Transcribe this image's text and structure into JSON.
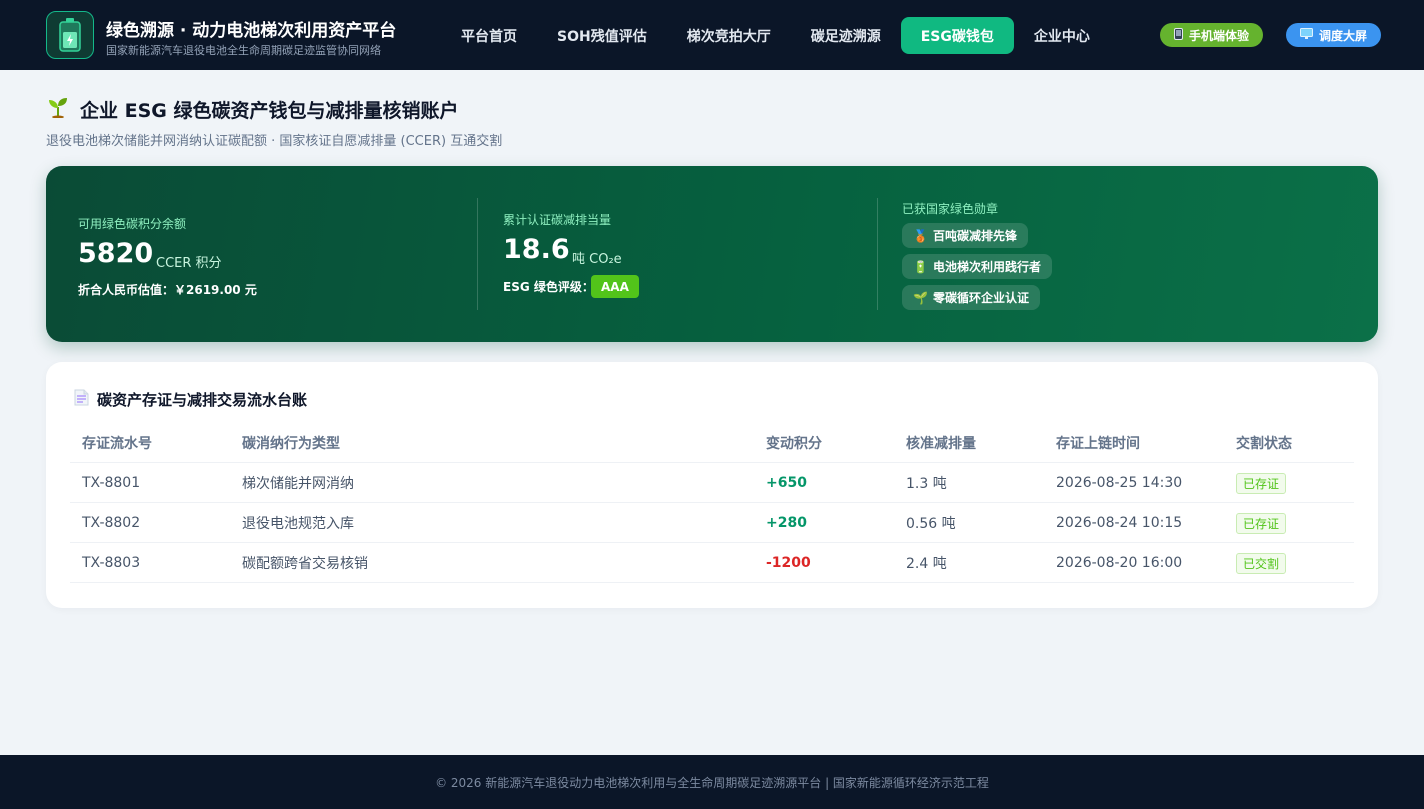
{
  "header": {
    "brand_title": "绿色溯源 · 动力电池梯次利用资产平台",
    "brand_subtitle": "国家新能源汽车退役电池全生命周期碳足迹监管协同网络",
    "nav": [
      {
        "label": "平台首页",
        "active": false
      },
      {
        "label": "SOH残值评估",
        "active": false
      },
      {
        "label": "梯次竞拍大厅",
        "active": false
      },
      {
        "label": "碳足迹溯源",
        "active": false
      },
      {
        "label": "ESG碳钱包",
        "active": true
      },
      {
        "label": "企业中心",
        "active": false
      }
    ],
    "mobile_label": "手机端体验",
    "screen_label": "调度大屏"
  },
  "page": {
    "title": "企业 ESG 绿色碳资产钱包与减排量核销账户",
    "subtitle": "退役电池梯次储能并网消纳认证碳配额 · 国家核证自愿减排量 (CCER) 互通交割"
  },
  "wallet": {
    "balance_label": "可用绿色碳积分余额",
    "balance_value": "5820",
    "balance_unit": "CCER 积分",
    "rmb_estimate": "折合人民币估值：￥2619.00 元",
    "reduction_label": "累计认证碳减排当量",
    "reduction_value": "18.6",
    "reduction_unit": "吨 CO₂e",
    "rating_label": "ESG 绿色评级：",
    "rating_value": "AAA",
    "medals_label": "已获国家绿色勋章",
    "medals": [
      {
        "icon": "🥉",
        "label": "百吨碳减排先锋"
      },
      {
        "icon": "🔋",
        "label": "电池梯次利用践行者"
      },
      {
        "icon": "🌱",
        "label": "零碳循环企业认证"
      }
    ]
  },
  "ledger": {
    "title": "碳资产存证与减排交易流水台账",
    "columns": [
      "存证流水号",
      "碳消纳行为类型",
      "变动积分",
      "核准减排量",
      "存证上链时间",
      "交割状态"
    ],
    "rows": [
      {
        "id": "TX-8801",
        "type": "梯次储能并网消纳",
        "points": "+650",
        "reduction": "1.3 吨",
        "time": "2026-08-25 14:30",
        "status": "已存证"
      },
      {
        "id": "TX-8802",
        "type": "退役电池规范入库",
        "points": "+280",
        "reduction": "0.56 吨",
        "time": "2026-08-24 10:15",
        "status": "已存证"
      },
      {
        "id": "TX-8803",
        "type": "碳配额跨省交易核销",
        "points": "-1200",
        "reduction": "2.4 吨",
        "time": "2026-08-20 16:00",
        "status": "已交割"
      }
    ]
  },
  "footer": {
    "text": "© 2026 新能源汽车退役动力电池梯次利用与全生命周期碳足迹溯源平台 | 国家新能源循环经济示范工程"
  },
  "colors": {
    "accent": "#10b981",
    "header_bg": "#0b1628",
    "wallet_bg": "#06613f",
    "positive": "#059669",
    "negative": "#dc2626",
    "status_green": "#52c41a"
  }
}
